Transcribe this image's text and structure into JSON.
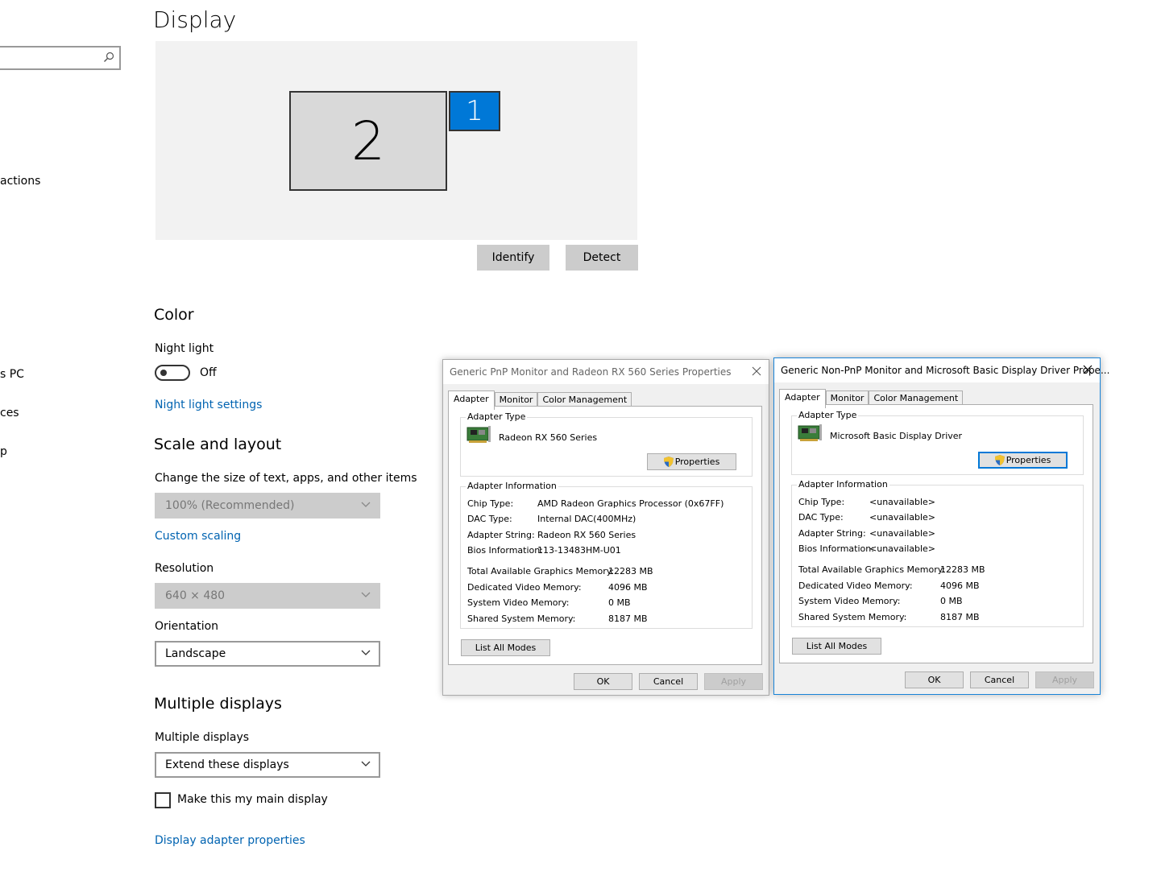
{
  "sidebar": {
    "search_placeholder": "",
    "items": [
      "actions",
      "s PC",
      "ces",
      "p"
    ]
  },
  "main": {
    "title": "Display",
    "monitors": [
      {
        "label": "2"
      },
      {
        "label": "1"
      }
    ],
    "identify": "Identify",
    "detect": "Detect",
    "color": {
      "heading": "Color",
      "night_light_label": "Night light",
      "night_light_state": "Off",
      "night_light_settings": "Night light settings"
    },
    "scale": {
      "heading": "Scale and layout",
      "size_label": "Change the size of text, apps, and other items",
      "size_value": "100% (Recommended)",
      "custom_scaling": "Custom scaling",
      "resolution_label": "Resolution",
      "resolution_value": "640 × 480",
      "orientation_label": "Orientation",
      "orientation_value": "Landscape"
    },
    "multi": {
      "heading": "Multiple displays",
      "label": "Multiple displays",
      "value": "Extend these displays",
      "main_display": "Make this my main display",
      "adapter_props": "Display adapter properties"
    }
  },
  "dialog1": {
    "title": "Generic PnP Monitor and Radeon RX 560 Series Properties",
    "tabs": [
      "Adapter",
      "Monitor",
      "Color Management"
    ],
    "adapter_type_label": "Adapter Type",
    "adapter_name": "Radeon RX 560 Series",
    "properties": "Properties",
    "adapter_info_label": "Adapter Information",
    "info": [
      {
        "label": "Chip Type:",
        "value": "AMD Radeon Graphics Processor (0x67FF)"
      },
      {
        "label": "DAC Type:",
        "value": "Internal DAC(400MHz)"
      },
      {
        "label": "Adapter String:",
        "value": "Radeon RX 560 Series"
      },
      {
        "label": "Bios Information:",
        "value": "113-13483HM-U01"
      }
    ],
    "memory": [
      {
        "label": "Total Available Graphics Memory:",
        "value": "12283 MB"
      },
      {
        "label": "Dedicated Video Memory:",
        "value": "4096 MB"
      },
      {
        "label": "System Video Memory:",
        "value": "0 MB"
      },
      {
        "label": "Shared System Memory:",
        "value": "8187 MB"
      }
    ],
    "list_modes": "List All Modes",
    "ok": "OK",
    "cancel": "Cancel",
    "apply": "Apply"
  },
  "dialog2": {
    "title": "Generic Non-PnP Monitor and Microsoft Basic Display Driver Prope...",
    "tabs": [
      "Adapter",
      "Monitor",
      "Color Management"
    ],
    "adapter_type_label": "Adapter Type",
    "adapter_name": "Microsoft Basic Display Driver",
    "properties": "Properties",
    "adapter_info_label": "Adapter Information",
    "info": [
      {
        "label": "Chip Type:",
        "value": "<unavailable>"
      },
      {
        "label": "DAC Type:",
        "value": "<unavailable>"
      },
      {
        "label": "Adapter String:",
        "value": "<unavailable>"
      },
      {
        "label": "Bios Information:",
        "value": "<unavailable>"
      }
    ],
    "memory": [
      {
        "label": "Total Available Graphics Memory:",
        "value": "12283 MB"
      },
      {
        "label": "Dedicated Video Memory:",
        "value": "4096 MB"
      },
      {
        "label": "System Video Memory:",
        "value": "0 MB"
      },
      {
        "label": "Shared System Memory:",
        "value": "8187 MB"
      }
    ],
    "list_modes": "List All Modes",
    "ok": "OK",
    "cancel": "Cancel",
    "apply": "Apply"
  },
  "colors": {
    "accent": "#0078d7",
    "link": "#0063b1",
    "disabled_bg": "#cccccc"
  }
}
